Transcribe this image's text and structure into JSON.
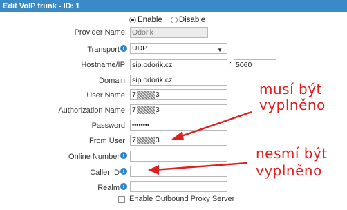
{
  "window": {
    "title": "Edit VoIP trunk - ID: 1"
  },
  "status": {
    "enable_label": "Enable",
    "disable_label": "Disable",
    "selected": "Enable"
  },
  "fields": {
    "provider_name": {
      "label": "Provider Name:",
      "value": "Odorik"
    },
    "transport": {
      "label": "Transport",
      "value": "UDP"
    },
    "hostname": {
      "label": "Hostname/IP:",
      "value": "sip.odorik.cz",
      "port": "5060"
    },
    "domain": {
      "label": "Domain:",
      "value": "sip.odorik.cz"
    },
    "user_name": {
      "label": "User Name:",
      "prefix": "7",
      "suffix": "3"
    },
    "authorization_name": {
      "label": "Authorization Name:",
      "prefix": "7",
      "suffix": "3"
    },
    "password": {
      "label": "Password:",
      "value": "••••••••"
    },
    "from_user": {
      "label": "From User:",
      "prefix": "7",
      "suffix": "3"
    },
    "online_number": {
      "label": "Online Number",
      "value": ""
    },
    "caller_id": {
      "label": "Caller ID",
      "value": ""
    },
    "realm": {
      "label": "Realm",
      "value": ""
    }
  },
  "outbound_proxy": {
    "label": "Enable Outbound Proxy Server",
    "checked": false
  },
  "annotations": {
    "must_fill_line1": "musí být",
    "must_fill_line2": "vyplněno",
    "must_not_fill_line1": "nesmí být",
    "must_not_fill_line2": "vyplněno",
    "color": "#e01f1f"
  },
  "colors": {
    "header_bg": "#3a8ac8",
    "info_icon": "#2f82d2"
  }
}
